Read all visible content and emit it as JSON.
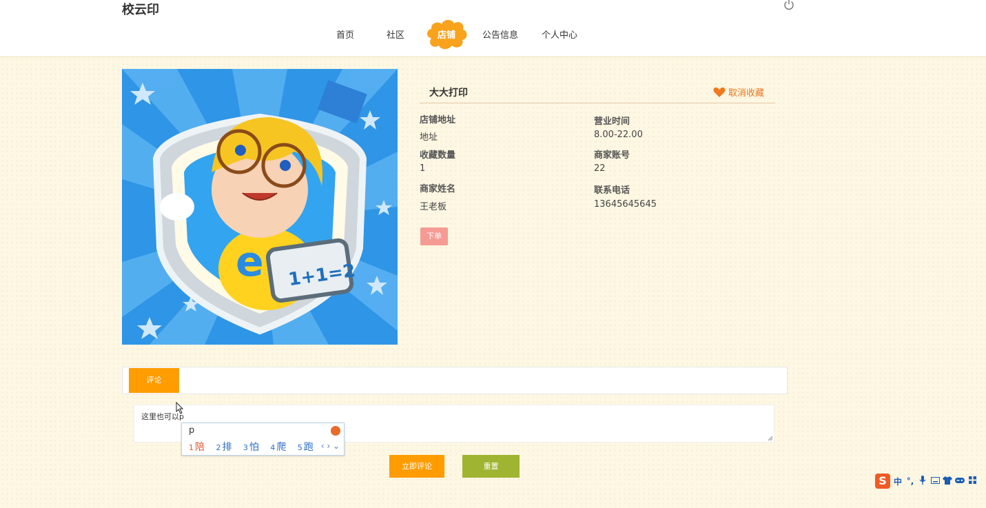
{
  "app": {
    "title": "校云印"
  },
  "nav": {
    "items": [
      "首页",
      "社区",
      "店铺",
      "公告信息",
      "个人中心"
    ],
    "active": "店铺"
  },
  "shop": {
    "name": "大大打印",
    "favorite_label": "取消收藏",
    "fields": {
      "address_label": "店铺地址",
      "address_value": "地址",
      "hours_label": "营业时间",
      "hours_value": "8.00-22.00",
      "fav_count_label": "收藏数量",
      "fav_count_value": "1",
      "account_label": "商家账号",
      "account_value": "22",
      "owner_label": "商家姓名",
      "owner_value": "王老板",
      "phone_label": "联系电话",
      "phone_value": "13645645645"
    },
    "order_button": "下单",
    "image_text": "1+1=2"
  },
  "comments": {
    "tab_label": "评论",
    "input_value": "这里也可以p",
    "submit_button": "立即评论",
    "reset_button": "重置"
  },
  "ime": {
    "composition": "p",
    "candidates": [
      {
        "n": "1",
        "text": "陪"
      },
      {
        "n": "2",
        "text": "排"
      },
      {
        "n": "3",
        "text": "怕"
      },
      {
        "n": "4",
        "text": "爬"
      },
      {
        "n": "5",
        "text": "跑"
      }
    ],
    "toolbar_logo": "S",
    "toolbar_mode": "中"
  },
  "colors": {
    "accent": "#ff9c00",
    "reset": "#9fb430",
    "order": "#f59b94",
    "favorite": "#e8761f",
    "page_bg": "#fdf7e3"
  }
}
